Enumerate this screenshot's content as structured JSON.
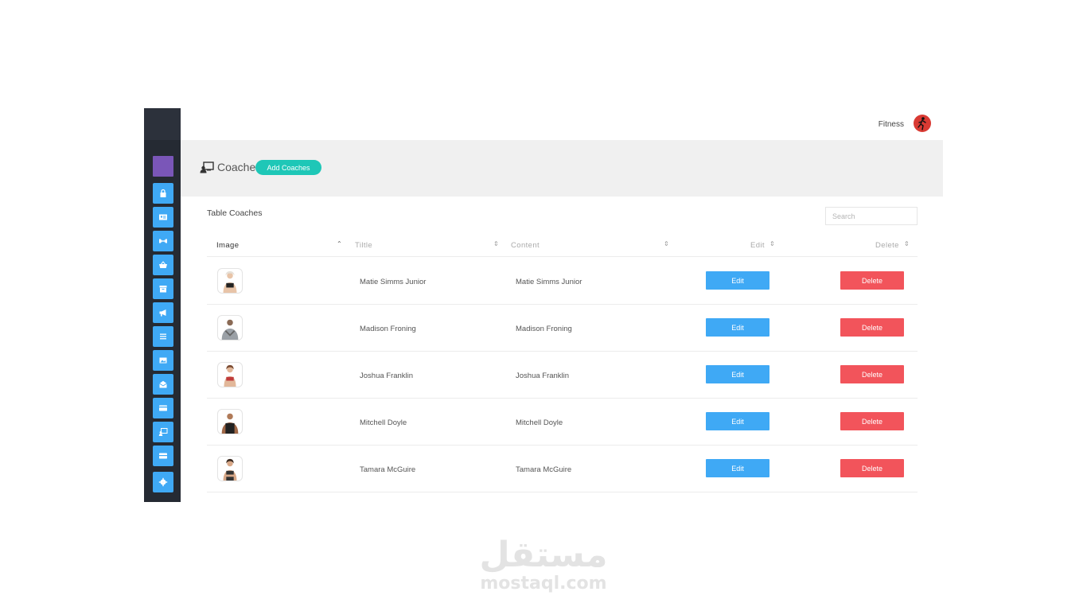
{
  "topbar": {
    "user_name": "Fitness"
  },
  "header": {
    "title": "Coaches",
    "add_button": "Add Coaches"
  },
  "table": {
    "title": "Table Coaches",
    "search_placeholder": "Search",
    "columns": [
      "Image",
      "Tiltle",
      "Content",
      "Edit",
      "Delete"
    ],
    "rows": [
      {
        "title": "Matie Simms Junior",
        "content": "Matie Simms Junior",
        "edit": "Edit",
        "delete": "Delete"
      },
      {
        "title": "Madison Froning",
        "content": "Madison Froning",
        "edit": "Edit",
        "delete": "Delete"
      },
      {
        "title": "Joshua Franklin",
        "content": "Joshua Franklin",
        "edit": "Edit",
        "delete": "Delete"
      },
      {
        "title": "Mitchell Doyle",
        "content": "Mitchell Doyle",
        "edit": "Edit",
        "delete": "Delete"
      },
      {
        "title": "Tamara McGuire",
        "content": "Tamara McGuire",
        "edit": "Edit",
        "delete": "Delete"
      }
    ]
  },
  "sidebar": {
    "items": [
      "lock-icon",
      "id-card-icon",
      "dumbbell-icon",
      "basket-icon",
      "archive-icon",
      "megaphone-icon",
      "list-icon",
      "image-icon",
      "envelope-open-icon",
      "credit-card-icon",
      "coaches-icon",
      "card-icon",
      "gear-icon"
    ]
  },
  "watermark": {
    "arabic": "مستقل",
    "latin": "mostaql.com"
  },
  "colors": {
    "sidebar_bg": "#252a33",
    "accent_blue": "#3fa9f5",
    "brand_purple": "#7a56b8",
    "teal": "#1ec7b7",
    "danger": "#f2545b"
  }
}
